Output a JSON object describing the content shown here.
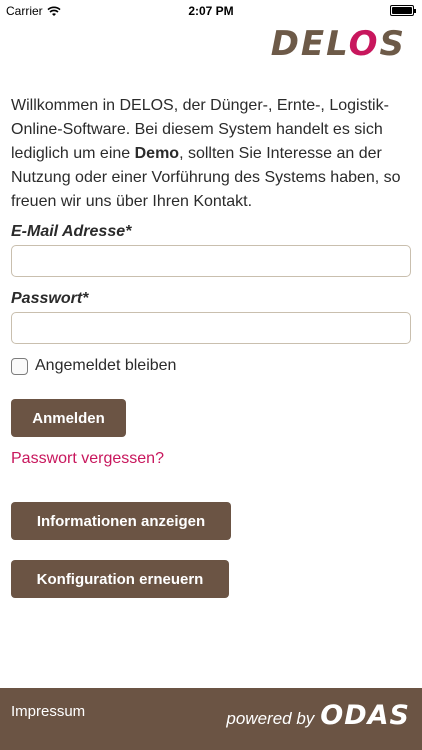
{
  "status_bar": {
    "carrier": "Carrier",
    "time": "2:07 PM"
  },
  "logo": {
    "prefix": "DEL",
    "accent": "O",
    "suffix": "S"
  },
  "intro": {
    "before_bold": "Willkommen in DELOS, der Dünger-, Ernte-, Logistik-Online-Software. Bei diesem System handelt es sich lediglich um eine ",
    "bold": "Demo",
    "after_bold": ", sollten Sie Interesse an der Nutzung oder einer Vorführung des Systems haben, so freuen wir uns über Ihren Kontakt."
  },
  "form": {
    "email_label": "E-Mail Adresse*",
    "email_value": "",
    "password_label": "Passwort*",
    "password_value": "",
    "remember_label": "Angemeldet bleiben",
    "remember_checked": false,
    "login_button": "Anmelden",
    "forgot_link": "Passwort vergessen?"
  },
  "actions": {
    "info_button": "Informationen anzeigen",
    "config_button": "Konfiguration erneuern"
  },
  "footer": {
    "impressum": "Impressum",
    "powered_by": "powered by",
    "brand": "ODAS"
  },
  "colors": {
    "brand_brown": "#6b5444",
    "accent_pink": "#c8175d"
  }
}
